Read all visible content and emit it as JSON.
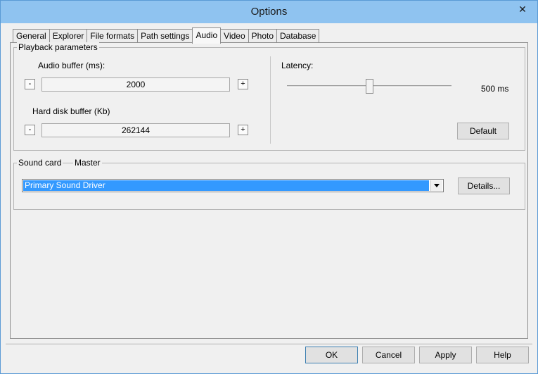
{
  "window": {
    "title": "Options",
    "close_glyph": "✕"
  },
  "tabs": [
    {
      "label": "General"
    },
    {
      "label": "Explorer"
    },
    {
      "label": "File formats"
    },
    {
      "label": "Path settings"
    },
    {
      "label": "Audio",
      "active": true
    },
    {
      "label": "Video"
    },
    {
      "label": "Photo"
    },
    {
      "label": "Database"
    }
  ],
  "playback": {
    "group_label": "Playback parameters",
    "audio_buffer": {
      "label": "Audio buffer (ms):",
      "value": "2000",
      "minus": "-",
      "plus": "+"
    },
    "disk_buffer": {
      "label": "Hard disk buffer (Kb)",
      "value": "262144",
      "minus": "-",
      "plus": "+"
    },
    "latency": {
      "label": "Latency:",
      "value_text": "500 ms",
      "level": 0.5
    },
    "default_button": "Default"
  },
  "sound_card": {
    "group_label": "Sound card",
    "master_label": "Master",
    "selected": "Primary Sound Driver",
    "details_button": "Details..."
  },
  "dialog_buttons": {
    "ok": "OK",
    "cancel": "Cancel",
    "apply": "Apply",
    "help": "Help"
  },
  "colors": {
    "selection": "#3399ff",
    "titlebar": "#8fc3f0"
  }
}
